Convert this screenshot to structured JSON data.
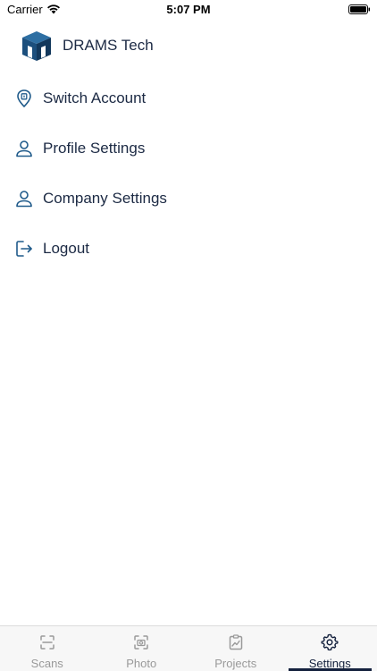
{
  "status_bar": {
    "carrier": "Carrier",
    "time": "5:07 PM"
  },
  "header": {
    "company_name": "DRAMS Tech"
  },
  "menu": {
    "items": [
      {
        "label": "Switch Account",
        "icon": "location-pin-icon"
      },
      {
        "label": "Profile Settings",
        "icon": "user-icon"
      },
      {
        "label": "Company Settings",
        "icon": "user-icon"
      },
      {
        "label": "Logout",
        "icon": "logout-icon"
      }
    ]
  },
  "tab_bar": {
    "tabs": [
      {
        "label": "Scans",
        "icon": "scan-icon",
        "active": false
      },
      {
        "label": "Photo",
        "icon": "camera-icon",
        "active": false
      },
      {
        "label": "Projects",
        "icon": "clipboard-chart-icon",
        "active": false
      },
      {
        "label": "Settings",
        "icon": "gear-icon",
        "active": true
      }
    ]
  },
  "colors": {
    "primary": "#14213d",
    "icon_blue": "#1f5a8a",
    "inactive": "#9a9a9a"
  }
}
